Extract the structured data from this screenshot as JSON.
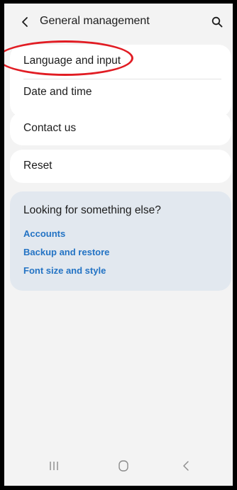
{
  "header": {
    "title": "General management",
    "back_icon": "chevron-left-icon",
    "search_icon": "search-icon"
  },
  "menu": {
    "items": [
      {
        "label": "Language and input"
      },
      {
        "label": "Date and time"
      },
      {
        "label": "Contact us"
      },
      {
        "label": "Reset"
      }
    ]
  },
  "suggestions": {
    "title": "Looking for something else?",
    "links": [
      {
        "label": "Accounts"
      },
      {
        "label": "Backup and restore"
      },
      {
        "label": "Font size and style"
      }
    ]
  },
  "navbar": {
    "recents_icon": "recents-icon",
    "home_icon": "home-icon",
    "back_icon": "back-icon"
  },
  "colors": {
    "background": "#f3f3f3",
    "card": "#ffffff",
    "suggestion_card": "#e2e8ef",
    "link": "#2373c4",
    "highlight_annotation": "#e11c23"
  }
}
